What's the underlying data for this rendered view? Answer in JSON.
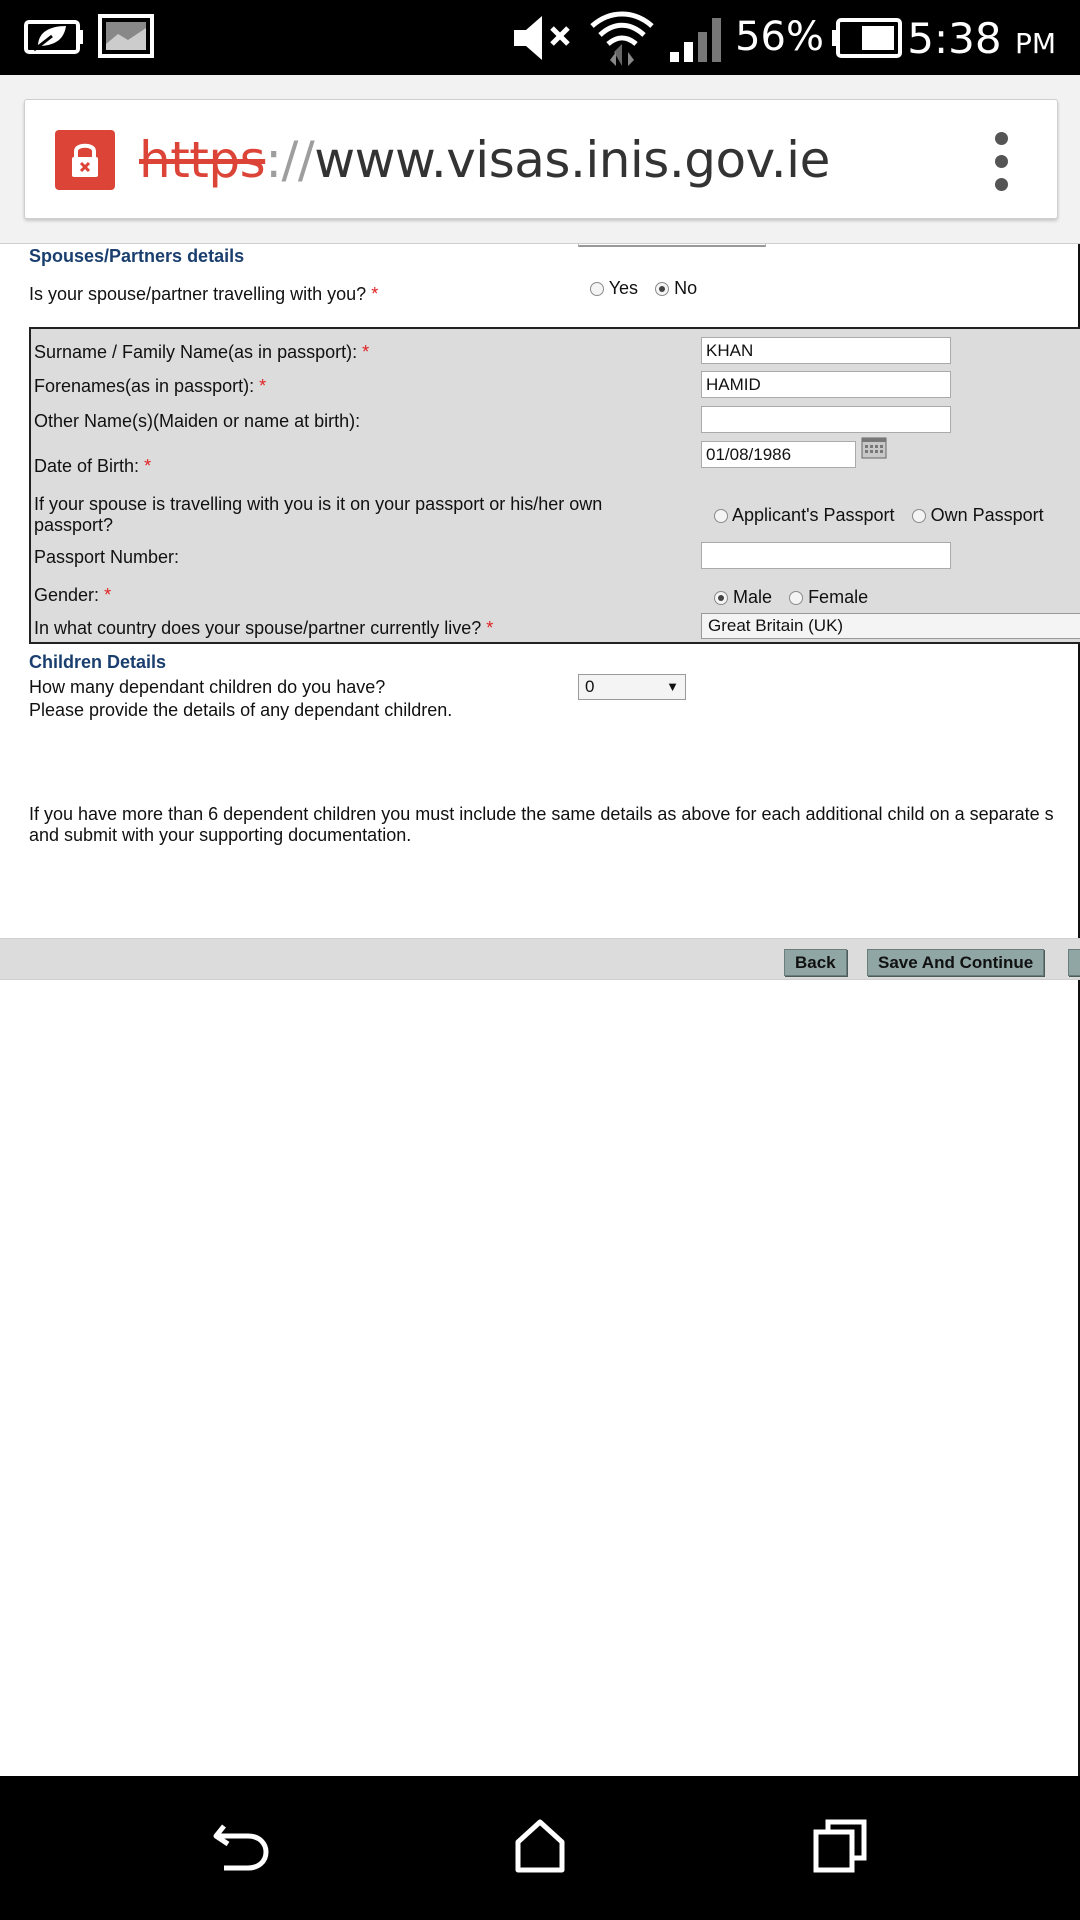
{
  "status_bar": {
    "battery_percent": "56%",
    "time": "5:38",
    "time_suffix": "PM",
    "icons": [
      "eco-battery-icon",
      "image-icon",
      "mute-icon",
      "wifi-icon",
      "signal-icon",
      "battery-icon"
    ]
  },
  "browser": {
    "url_scheme": "https",
    "url_separator": "://",
    "url_host": "www.visas.inis.gov.ie",
    "icons": [
      "lock-error-icon",
      "overflow-menu-icon"
    ]
  },
  "spouse_section": {
    "title": "Spouses/Partners details",
    "travelling_question": "Is your spouse/partner travelling with you?",
    "required_mark": "*",
    "travelling_options": [
      {
        "label": "Yes",
        "selected": false
      },
      {
        "label": "No",
        "selected": true
      }
    ],
    "surname_label": "Surname / Family Name(as in passport):",
    "surname_value": "KHAN",
    "forenames_label": "Forenames(as in passport):",
    "forenames_value": "HAMID",
    "other_names_label": "Other Name(s)(Maiden or name at birth):",
    "other_names_value": "",
    "dob_label": "Date of Birth:",
    "dob_value": "01/08/1986",
    "passport_question_line1": "If your spouse is travelling with you is it on your passport or his/her own",
    "passport_question_line2": "passport?",
    "passport_options": [
      {
        "label": "Applicant's Passport",
        "selected": false
      },
      {
        "label": "Own Passport",
        "selected": false
      }
    ],
    "passport_number_label": "Passport Number:",
    "passport_number_value": "",
    "gender_label": "Gender:",
    "gender_options": [
      {
        "label": "Male",
        "selected": true
      },
      {
        "label": "Female",
        "selected": false
      }
    ],
    "country_label": "In what country does your spouse/partner currently live?",
    "country_value": "Great Britain (UK)"
  },
  "children_section": {
    "title": "Children Details",
    "count_question": "How many dependant children do you have?",
    "count_value": "0",
    "details_prompt": "Please provide the details of any dependant children.",
    "note_line1": "If you have more than 6 dependent children you must include the same details as above for each additional child on a separate s",
    "note_line2": "and submit with your supporting documentation."
  },
  "actions": {
    "back_label": "Back",
    "save_continue_label": "Save And Continue"
  },
  "nav_bar": {
    "icons": [
      "back-icon",
      "home-icon",
      "recents-icon"
    ]
  },
  "colors": {
    "section_title": "#1a3f6f",
    "required": "#e02020",
    "panel_bg": "#dcdcdc",
    "button_bg": "#8fa6a4",
    "insecure_red": "#db4437"
  }
}
